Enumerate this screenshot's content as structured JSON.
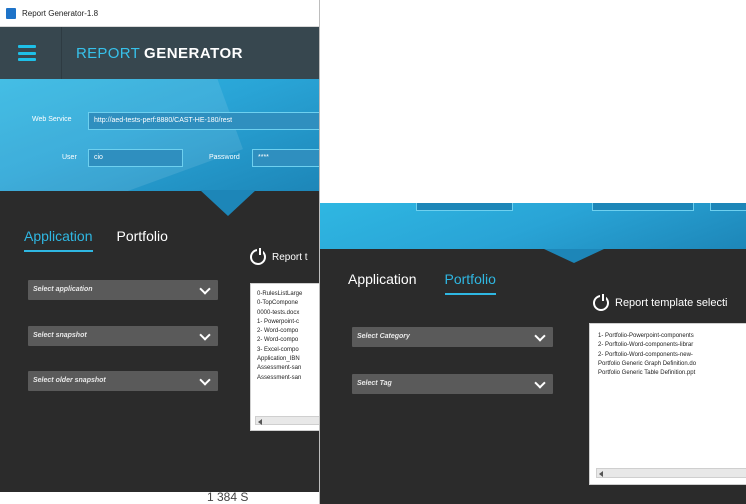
{
  "window1": {
    "title": "Report Generator-1.8",
    "brand_light": "REPORT",
    "brand_bold": "GENERATOR",
    "web_service_label": "Web Service",
    "web_service_value": "http://aed-tests-perf:8880/CAST-HE-180/rest",
    "user_label": "User",
    "user_value": "cio",
    "password_label": "Password",
    "password_value": "****",
    "tabs": [
      {
        "label": "Application",
        "active": true
      },
      {
        "label": "Portfolio",
        "active": false
      }
    ],
    "selects": [
      "Select application",
      "Select snapshot",
      "Select older snapshot"
    ],
    "report_title": "Report t",
    "templates": [
      "0-RulesListLarge",
      "0-TopCompone",
      "0000-tests.docx",
      "1- Powerpoint-c",
      "2- Word-compo",
      "2- Word-compo",
      "3- Excel-compo",
      "Application_IBN",
      "Assessment-san",
      "Assessment-san"
    ],
    "stray_text": "1 384 S"
  },
  "window2": {
    "tabs": [
      {
        "label": "Application",
        "active": false
      },
      {
        "label": "Portfolio",
        "active": true
      }
    ],
    "selects": [
      "Select Category",
      "Select Tag"
    ],
    "report_title": "Report template selecti",
    "templates": [
      "1- Portfolio-Powerpoint-components",
      "2- Porftolio-Word-components-librar",
      "2- Porftolio-Word-components-new-",
      "Portfolio Generic Graph Definition.do",
      "Portfolio Generic Table Definition.ppt"
    ]
  },
  "colors": {
    "accent": "#2fb7e2",
    "header": "#37474f",
    "panel": "#2b2b2b",
    "select": "#5a5a5a"
  },
  "icons": [
    "menu-icon",
    "power-icon",
    "chevron-down-icon",
    "arrow-left-icon"
  ]
}
